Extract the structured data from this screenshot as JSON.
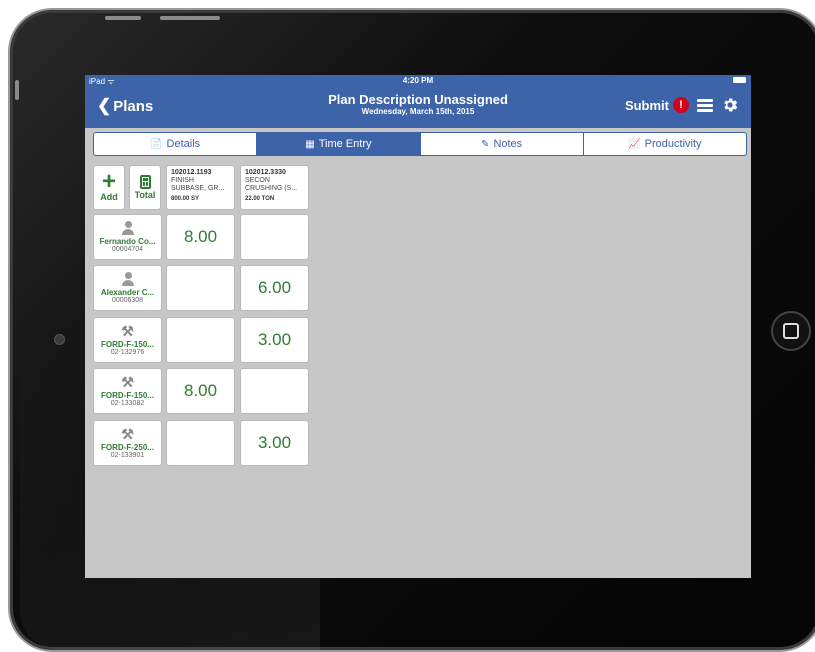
{
  "status_bar": {
    "carrier": "iPad ᯤ",
    "time": "4:20 PM"
  },
  "nav": {
    "back_label": "Plans",
    "title": "Plan Description Unassigned",
    "subtitle": "Wednesday, March 15th, 2015",
    "submit_label": "Submit",
    "alert_badge": "!"
  },
  "tabs": [
    {
      "label": "Details",
      "icon": "📄",
      "active": false
    },
    {
      "label": "Time Entry",
      "icon": "▦",
      "active": true
    },
    {
      "label": "Notes",
      "icon": "✎",
      "active": false
    },
    {
      "label": "Productivity",
      "icon": "📈",
      "active": false
    }
  ],
  "controls": {
    "add_label": "Add",
    "total_label": "Total"
  },
  "columns": [
    {
      "code": "102012.1193",
      "desc1": "FINISH",
      "desc2": "SUBBASE, GR...",
      "qty": "800.00 SY"
    },
    {
      "code": "102012.3330",
      "desc1": "SECON",
      "desc2": "CRUSHING (S...",
      "qty": "22.00 TON"
    }
  ],
  "rows": [
    {
      "type": "person",
      "name": "Fernando Co...",
      "id": "00004704",
      "values": [
        "8.00",
        ""
      ]
    },
    {
      "type": "person",
      "name": "Alexander C...",
      "id": "00006308",
      "values": [
        "",
        "6.00"
      ]
    },
    {
      "type": "equipment",
      "name": "FORD-F-150...",
      "id": "02-132976",
      "values": [
        "",
        "3.00"
      ]
    },
    {
      "type": "equipment",
      "name": "FORD-F-150...",
      "id": "02-133082",
      "values": [
        "8.00",
        ""
      ]
    },
    {
      "type": "equipment",
      "name": "FORD-F-250...",
      "id": "02-133901",
      "values": [
        "",
        "3.00"
      ]
    }
  ],
  "colors": {
    "brand": "#3d63a8",
    "accent_green": "#2e7d32",
    "alert": "#d0021b"
  }
}
